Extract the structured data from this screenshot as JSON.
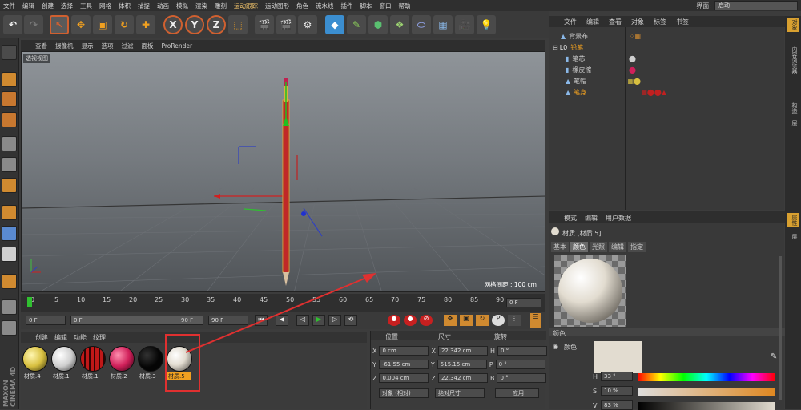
{
  "menu": [
    "文件",
    "编辑",
    "创建",
    "选择",
    "工具",
    "网格",
    "体积",
    "捕捉",
    "动画",
    "模拟",
    "渲染",
    "雕刻",
    "运动跟踪",
    "运动图形",
    "角色",
    "流水线",
    "插件",
    "脚本",
    "窗口",
    "帮助"
  ],
  "layout": {
    "label": "界面:",
    "value": "启动"
  },
  "toolbar": {
    "x": "X",
    "y": "Y",
    "z": "Z"
  },
  "viewport": {
    "menu": [
      "查看",
      "摄像机",
      "显示",
      "选项",
      "过滤",
      "面板",
      "ProRender"
    ],
    "label": "透视视图",
    "grid": "网格间距 : 100 cm"
  },
  "timeline": {
    "ticks": [
      "0",
      "5",
      "10",
      "15",
      "20",
      "25",
      "30",
      "35",
      "40",
      "45",
      "50",
      "55",
      "60",
      "65",
      "70",
      "75",
      "80",
      "85",
      "90"
    ],
    "frame": "0 F",
    "start": "0 F",
    "current": "0 F",
    "end": "90 F",
    "end2": "90 F"
  },
  "materials": {
    "menu": [
      "创建",
      "编辑",
      "功能",
      "纹理"
    ],
    "items": [
      {
        "name": "材质.4",
        "color": "#d8c040"
      },
      {
        "name": "材质.1",
        "color": "#dcdcdc"
      },
      {
        "name": "材质.1",
        "color": "#c01818"
      },
      {
        "name": "材质.2",
        "color": "#d0205a"
      },
      {
        "name": "材质.3",
        "color": "#050505"
      },
      {
        "name": "材质.5",
        "color": "#e2dcd0"
      }
    ]
  },
  "coords": {
    "headers": [
      "位置",
      "尺寸",
      "旋转"
    ],
    "rows": [
      {
        "a": "X",
        "pos": "0 cm",
        "s": "X",
        "size": "22.342 cm",
        "r": "H",
        "rot": "0 °"
      },
      {
        "a": "Y",
        "pos": "-61.55 cm",
        "s": "Y",
        "size": "515.15 cm",
        "r": "P",
        "rot": "0 °"
      },
      {
        "a": "Z",
        "pos": "0.004 cm",
        "s": "Z",
        "size": "22.342 cm",
        "r": "B",
        "rot": "0 °"
      }
    ],
    "mode1": "对象 (相对)",
    "mode2": "绝对尺寸",
    "apply": "应用"
  },
  "objects": {
    "tabs": [
      "文件",
      "编辑",
      "查看",
      "对象",
      "标签",
      "书签"
    ],
    "rows": [
      {
        "name": "背景布",
        "indent": 0
      },
      {
        "name": "铅笔",
        "indent": 0
      },
      {
        "name": "笔芯",
        "indent": 1
      },
      {
        "name": "橡皮擦",
        "indent": 1
      },
      {
        "name": "笔帽",
        "indent": 1
      },
      {
        "name": "笔身",
        "indent": 1
      }
    ]
  },
  "attributes": {
    "tabs": [
      "模式",
      "编辑",
      "用户数据"
    ],
    "title": "材质 [材质.5]",
    "subtabs": [
      "基本",
      "颜色",
      "光照",
      "编辑",
      "指定"
    ],
    "section": "颜色",
    "color_label": "颜色",
    "h": "33 °",
    "s": "10 %",
    "v": "83 %"
  },
  "right_tabs": [
    "对象",
    "内容浏览器",
    "构造",
    "层",
    "属性",
    "层"
  ]
}
